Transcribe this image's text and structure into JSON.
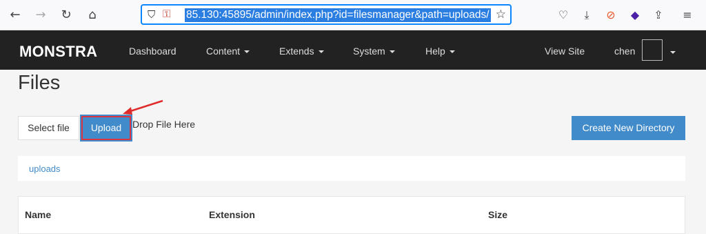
{
  "browser": {
    "url": "85.130:45895/admin/index.php?id=filesmanager&path=uploads/",
    "icons": [
      "back-icon",
      "forward-icon",
      "reload-icon",
      "home-icon",
      "shield-icon",
      "lock-icon",
      "star-icon",
      "pocket-icon",
      "download-icon",
      "blocker-icon",
      "extension-icon",
      "share-icon",
      "menu-icon"
    ]
  },
  "navbar": {
    "brand": "MONSTRA",
    "items": [
      "Dashboard",
      "Content",
      "Extends",
      "System",
      "Help"
    ],
    "view_site": "View Site",
    "user": "chen"
  },
  "page": {
    "title": "Files",
    "select_file": "Select file",
    "upload": "Upload",
    "drop_text": "Drop File Here",
    "create_dir": "Create New Directory",
    "breadcrumb": "uploads"
  },
  "table": {
    "columns": [
      "Name",
      "Extension",
      "Size"
    ]
  },
  "colors": {
    "navbar_bg": "#222222",
    "primary_button": "#428bca",
    "annotation_red": "#d9343f"
  }
}
